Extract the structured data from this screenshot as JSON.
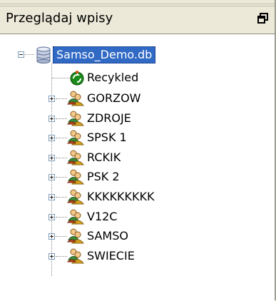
{
  "panel": {
    "title": "Przeglądaj wpisy",
    "pin_icon": "pin-icon"
  },
  "tree": {
    "root": {
      "label": "Samso_Demo.db",
      "icon": "database-icon",
      "expanded": true,
      "selected": true
    },
    "recycled": {
      "label": "Recykled",
      "icon": "recycle-icon"
    },
    "groups": [
      {
        "label": "GORZOW",
        "icon": "users-group-icon",
        "expanded": false
      },
      {
        "label": "ZDROJE",
        "icon": "users-group-icon",
        "expanded": false
      },
      {
        "label": "SPSK 1",
        "icon": "users-group-icon",
        "expanded": false
      },
      {
        "label": "RCKIK",
        "icon": "users-group-icon",
        "expanded": false
      },
      {
        "label": "PSK 2",
        "icon": "users-group-icon",
        "expanded": false
      },
      {
        "label": "KKKKKKKKK",
        "icon": "users-group-icon",
        "expanded": false
      },
      {
        "label": "V12C",
        "icon": "users-group-icon",
        "expanded": false
      },
      {
        "label": "SAMSO",
        "icon": "users-group-icon",
        "expanded": false
      },
      {
        "label": "SWIECIE",
        "icon": "users-group-icon",
        "expanded": false
      }
    ]
  },
  "colors": {
    "selection": "#316ac5",
    "background": "#ffffff",
    "chrome": "#ece9d8"
  }
}
